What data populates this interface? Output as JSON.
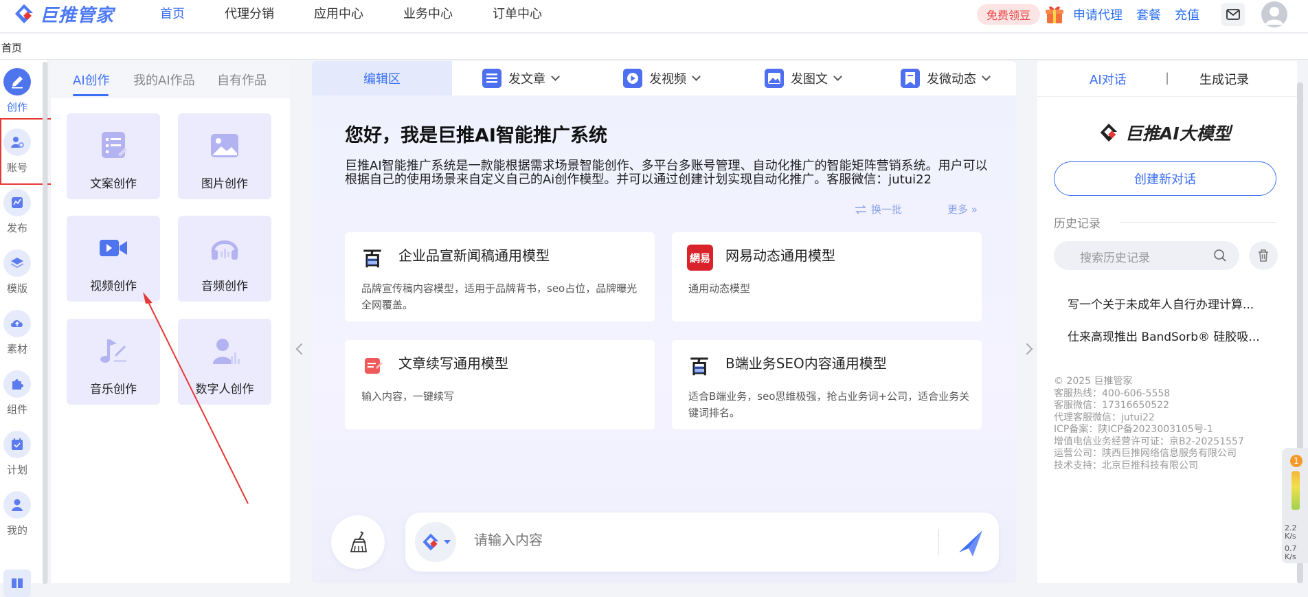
{
  "brand": {
    "name": "巨推管家"
  },
  "topnav": [
    "首页",
    "代理分销",
    "应用中心",
    "业务中心",
    "订单中心"
  ],
  "top_right": {
    "free": "免费领豆",
    "agent": "申请代理",
    "package": "套餐",
    "recharge": "充值"
  },
  "tabs": {
    "home": "首页"
  },
  "sidebar": {
    "items": [
      {
        "label": "创作",
        "icon": "pen-icon"
      },
      {
        "label": "账号",
        "icon": "user-add-icon"
      },
      {
        "label": "发布",
        "icon": "publish-icon"
      },
      {
        "label": "模版",
        "icon": "layers-icon"
      },
      {
        "label": "素材",
        "icon": "cloud-upload-icon"
      },
      {
        "label": "组件",
        "icon": "puzzle-icon"
      },
      {
        "label": "计划",
        "icon": "calendar-check-icon"
      },
      {
        "label": "我的",
        "icon": "person-icon"
      }
    ]
  },
  "create_panel": {
    "tabs": [
      "AI创作",
      "我的AI作品",
      "自有作品"
    ],
    "cards": [
      {
        "label": "文案创作",
        "icon": "document-icon"
      },
      {
        "label": "图片创作",
        "icon": "image-icon"
      },
      {
        "label": "视频创作",
        "icon": "video-icon"
      },
      {
        "label": "音频创作",
        "icon": "headphones-icon"
      },
      {
        "label": "音乐创作",
        "icon": "music-note-icon"
      },
      {
        "label": "数字人创作",
        "icon": "digital-human-icon"
      }
    ]
  },
  "editor": {
    "toolbar": {
      "edit": "编辑区",
      "items": [
        {
          "label": "发文章",
          "icon": "article-icon"
        },
        {
          "label": "发视频",
          "icon": "play-icon"
        },
        {
          "label": "发图文",
          "icon": "picture-icon"
        },
        {
          "label": "发微动态",
          "icon": "bookmark-icon"
        }
      ]
    },
    "greeting_title": "您好，我是巨推AI智能推广系统",
    "greeting_desc": "巨推AI智能推广系统是一款能根据需求场景智能创作、多平台多账号管理、自动化推广的智能矩阵营销系统。用户可以根据自己的使用场景来自定义自己的Ai创作模型。并可以通过创建计划实现自动化推广。客服微信：jutui22",
    "refresh": "换一批",
    "more": "更多 »",
    "models": [
      {
        "title": "企业品宣新闻稿通用模型",
        "desc": "品牌宣传稿内容模型，适用于品牌背书，seo占位，品牌曝光全网覆盖。",
        "icon": "baidu-style-icon"
      },
      {
        "title": "网易动态通用模型",
        "desc": "通用动态模型",
        "icon": "netease-icon"
      },
      {
        "title": "文章续写通用模型",
        "desc": "输入内容，一键续写",
        "icon": "write-icon"
      },
      {
        "title": "B端业务SEO内容通用模型",
        "desc": "适合B端业务，seo思维极强，抢占业务词+公司，适合业务关键词排名。",
        "icon": "baidu-style-icon"
      }
    ],
    "input_placeholder": "请输入内容"
  },
  "right_panel": {
    "tab_chat": "AI对话",
    "tab_sep": "|",
    "tab_records": "生成记录",
    "brand": "巨推AI大模型",
    "new_chat": "创建新对话",
    "history_label": "历史记录",
    "search_placeholder": "搜索历史记录",
    "history": [
      "写一个关于未成年人自行办理计算...",
      "仕来高现推出 BandSorb® 硅胶吸..."
    ],
    "footer": [
      "© 2025 巨推管家",
      "客服热线：400-606-5558",
      "客服微信：17316650522",
      "代理客服微信：jutui22",
      "ICP备案：陕ICP备2023003105号-1",
      "增值电信业务经营许可证：京B2-20251557",
      "运营公司：陕西巨推网络信息服务有限公司",
      "技术支持：北京巨推科技有限公司"
    ]
  },
  "net_widget": {
    "badge": "1",
    "up": "2.2",
    "up_unit": "K/s",
    "down": "0.7",
    "down_unit": "K/s"
  },
  "colors": {
    "accent": "#3b6ff5",
    "card_bg": "#ecebfd",
    "highlight": "#e53935"
  }
}
